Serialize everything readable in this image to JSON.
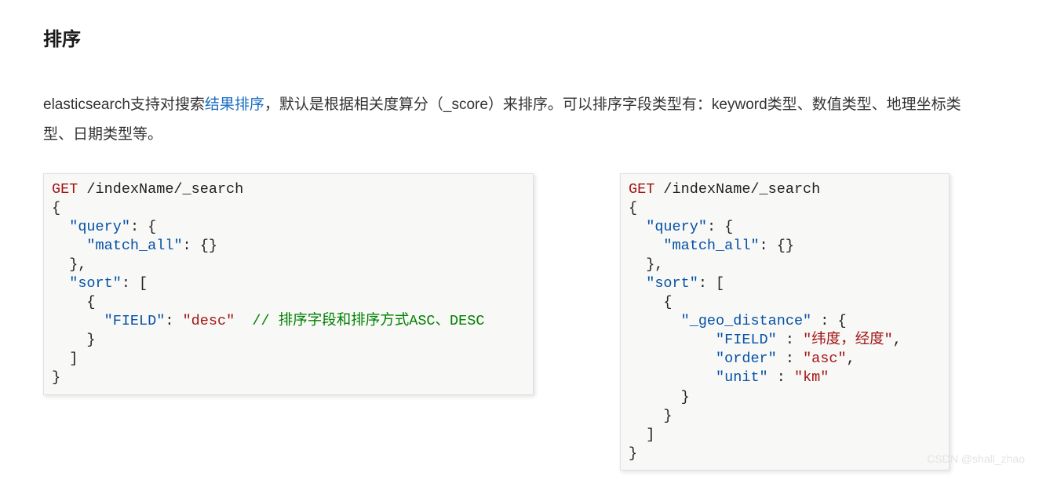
{
  "heading": "排序",
  "para": {
    "t1": "elasticsearch支持对搜索",
    "link": "结果排序",
    "t2": "，默认是根据相关度算分（_score）来排序。可以排序字段类型有：keyword类型、数值类型、地理坐标类型、日期类型等。"
  },
  "code_left": {
    "l01a": "GET",
    "l01b": " /indexName/_search",
    "l02": "{",
    "l03a": "  ",
    "l03b": "\"query\"",
    "l03c": ": {",
    "l04a": "    ",
    "l04b": "\"match_all\"",
    "l04c": ": {}",
    "l05": "  },",
    "l06a": "  ",
    "l06b": "\"sort\"",
    "l06c": ": [",
    "l07": "    {",
    "l08a": "      ",
    "l08b": "\"FIELD\"",
    "l08c": ": ",
    "l08d": "\"desc\"",
    "l08e": "  ",
    "l08f": "// 排序字段和排序方式ASC、DESC",
    "l09": "    }",
    "l10": "  ]",
    "l11": "}"
  },
  "code_right": {
    "l01a": "GET",
    "l01b": " /indexName/_search",
    "l02": "{",
    "l03a": "  ",
    "l03b": "\"query\"",
    "l03c": ": {",
    "l04a": "    ",
    "l04b": "\"match_all\"",
    "l04c": ": {}",
    "l05": "  },",
    "l06a": "  ",
    "l06b": "\"sort\"",
    "l06c": ": [",
    "l07": "    {",
    "l08a": "      ",
    "l08b": "\"_geo_distance\"",
    "l08c": " : {",
    "l09a": "          ",
    "l09b": "\"FIELD\"",
    "l09c": " : ",
    "l09d": "\"纬度，经度\"",
    "l09e": ",",
    "l10a": "          ",
    "l10b": "\"order\"",
    "l10c": " : ",
    "l10d": "\"asc\"",
    "l10e": ",",
    "l11a": "          ",
    "l11b": "\"unit\"",
    "l11c": " : ",
    "l11d": "\"km\"",
    "l12": "      }",
    "l13": "    }",
    "l14": "  ]",
    "l15": "}"
  },
  "watermark": "CSDN @shall_zhao"
}
